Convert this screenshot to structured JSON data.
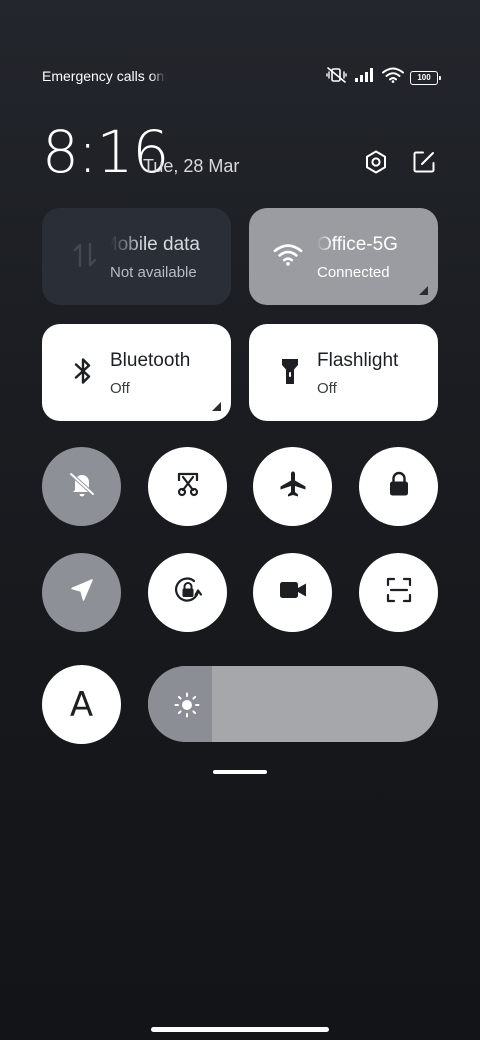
{
  "status_bar": {
    "carrier_text": "Emergency calls only",
    "battery_level": "100",
    "icons": [
      "mute-vibrate-icon",
      "signal-icon",
      "wifi-icon",
      "battery-icon"
    ]
  },
  "header": {
    "time": "8:16",
    "date": "Tue, 28 Mar",
    "actions": [
      "settings-icon",
      "edit-icon"
    ]
  },
  "tiles": {
    "mobile_data": {
      "title": "Mobile data",
      "subtitle": "Not available",
      "state": "unavailable"
    },
    "wifi": {
      "title": "Office-5G",
      "subtitle": "Connected",
      "state": "on"
    },
    "bluetooth": {
      "title": "Bluetooth",
      "subtitle": "Off",
      "state": "off"
    },
    "flashlight": {
      "title": "Flashlight",
      "subtitle": "Off",
      "state": "off"
    }
  },
  "toggles": [
    {
      "name": "mute-toggle",
      "icon": "bell-off-icon",
      "state": "on"
    },
    {
      "name": "screenshot-toggle",
      "icon": "scissors-frame-icon",
      "state": "off"
    },
    {
      "name": "airplane-mode-toggle",
      "icon": "airplane-icon",
      "state": "off"
    },
    {
      "name": "lock-screen-toggle",
      "icon": "lock-icon",
      "state": "off"
    },
    {
      "name": "location-toggle",
      "icon": "location-arrow-icon",
      "state": "on"
    },
    {
      "name": "rotation-lock-toggle",
      "icon": "rotation-lock-icon",
      "state": "off"
    },
    {
      "name": "screen-recorder-toggle",
      "icon": "video-camera-icon",
      "state": "off"
    },
    {
      "name": "scanner-toggle",
      "icon": "scan-frame-icon",
      "state": "off"
    }
  ],
  "font_button": {
    "label": "A"
  },
  "brightness": {
    "level_fraction": 0.22
  },
  "colors": {
    "active_tile": "#9a9ca2",
    "inactive_tile": "#ffffff",
    "unavailable_tile": "#2a2e36",
    "active_round": "#8e9098",
    "slider_track": "#a6a7aa",
    "slider_fill": "#8b8e95"
  }
}
